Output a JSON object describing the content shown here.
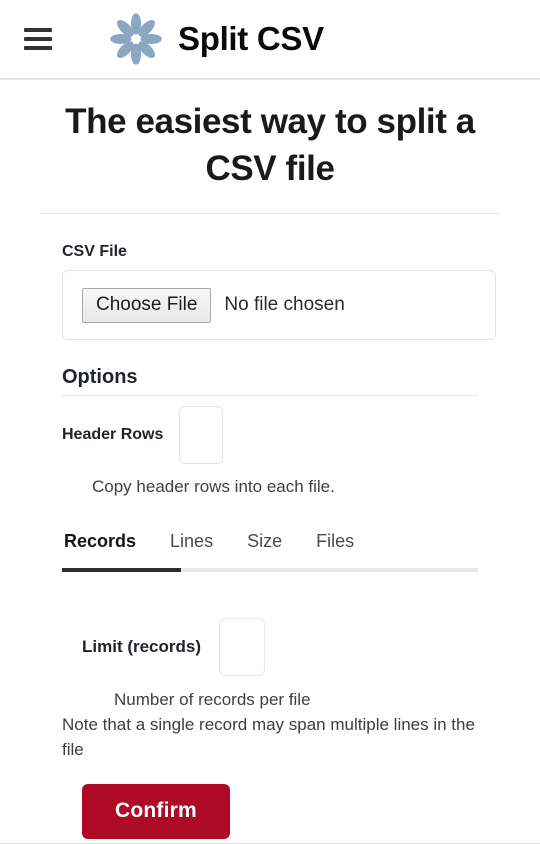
{
  "header": {
    "menu_icon": "hamburger-menu-icon",
    "logo_icon": "flower-logo-icon",
    "logo_color": "#8aa8c2",
    "brand_title": "Split CSV"
  },
  "hero": {
    "heading": "The easiest way to split a CSV file"
  },
  "form": {
    "file_field": {
      "label": "CSV File",
      "button_label": "Choose File",
      "status_text": "No file chosen"
    },
    "options": {
      "section_title": "Options",
      "header_rows": {
        "label": "Header Rows",
        "value": "",
        "help": "Copy header rows into each file."
      }
    },
    "tabs": {
      "active_index": 0,
      "items": [
        {
          "label": "Records"
        },
        {
          "label": "Lines"
        },
        {
          "label": "Size"
        },
        {
          "label": "Files"
        }
      ]
    },
    "limit": {
      "label": "Limit (records)",
      "value": "",
      "help": "Number of records per file",
      "note": "Note that a single record may span multiple lines in the file"
    },
    "confirm": {
      "label": "Confirm",
      "color": "#ad0a28"
    }
  }
}
